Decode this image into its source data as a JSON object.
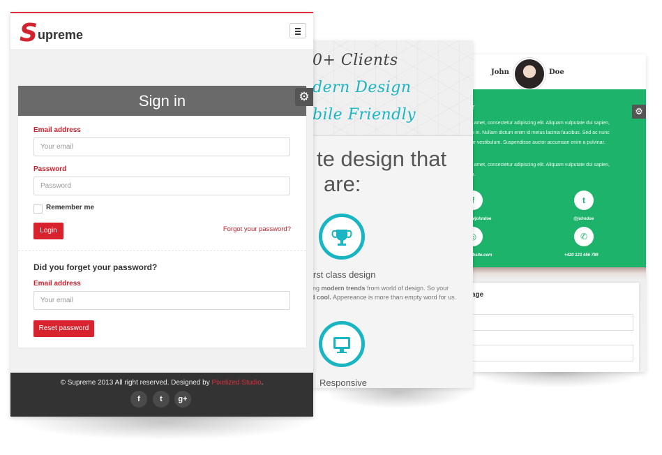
{
  "left_screen": {
    "logo": {
      "initial": "S",
      "rest": "upreme"
    },
    "signin": {
      "title": "Sign in",
      "email_label": "Email address",
      "email_placeholder": "Your email",
      "password_label": "Password",
      "password_placeholder": "Password",
      "remember_label": "Remember me",
      "login_button": "Login",
      "forgot_link": "Forgot your password?",
      "forgot_heading": "Did you forget your password?",
      "reset_email_label": "Email address",
      "reset_email_placeholder": "Your email",
      "reset_button": "Reset password"
    },
    "footer": {
      "text": "© Supreme 2013 All right reserved. Designed by ",
      "studio": "Pixelized Studio",
      "period": ".",
      "social": [
        {
          "icon": "facebook-icon",
          "glyph": "f"
        },
        {
          "icon": "twitter-icon",
          "glyph": "🐦"
        },
        {
          "icon": "google-plus-icon",
          "glyph": "g+"
        }
      ]
    }
  },
  "middle_screen": {
    "hand_lines": [
      {
        "text": "0+ Clients",
        "color": "#444444"
      },
      {
        "text": "dern Design",
        "color": "#19b5c2"
      },
      {
        "text": "bile Friendly",
        "color": "#19b5c2"
      }
    ],
    "headline_1": "te design that",
    "headline_2": "are:",
    "features": [
      {
        "icon": "trophy-icon",
        "title": "irst class design",
        "desc_a": "ing ",
        "desc_b": "modern trends",
        "desc_c": " from world of design. So your",
        "desc2_a": "d cool.",
        "desc2_b": " Appereance is more than empty word for us."
      },
      {
        "icon": "monitor-icon",
        "title": "Responsive"
      }
    ],
    "accent": "#19b5c2"
  },
  "right_screen": {
    "first_name": "John",
    "last_name": "Doe",
    "section_title": "r",
    "para1": [
      "it amet, consectetur adipiscing elit. Aliquam vulputate dui sapien,",
      "m in. Nullam dictum enim id metus lacinia faucibus. Sed ac nunc",
      "ue vestibulum. Suspendisse auctor accumsan enim a pulvinar."
    ],
    "para2": [
      "it amet, consectetur adipiscing elit. Aliquam vulputate dui sapien,",
      "in."
    ],
    "contacts": [
      {
        "icon": "facebook-icon",
        "label": "m/johndoe"
      },
      {
        "icon": "twitter-icon",
        "label": "@johndoe"
      },
      {
        "icon": "globe-icon",
        "label": "ebsite.com"
      },
      {
        "icon": "phone-icon",
        "label": "+420 123 456 789"
      }
    ],
    "form_title": "age",
    "accent": "#1db36a"
  }
}
